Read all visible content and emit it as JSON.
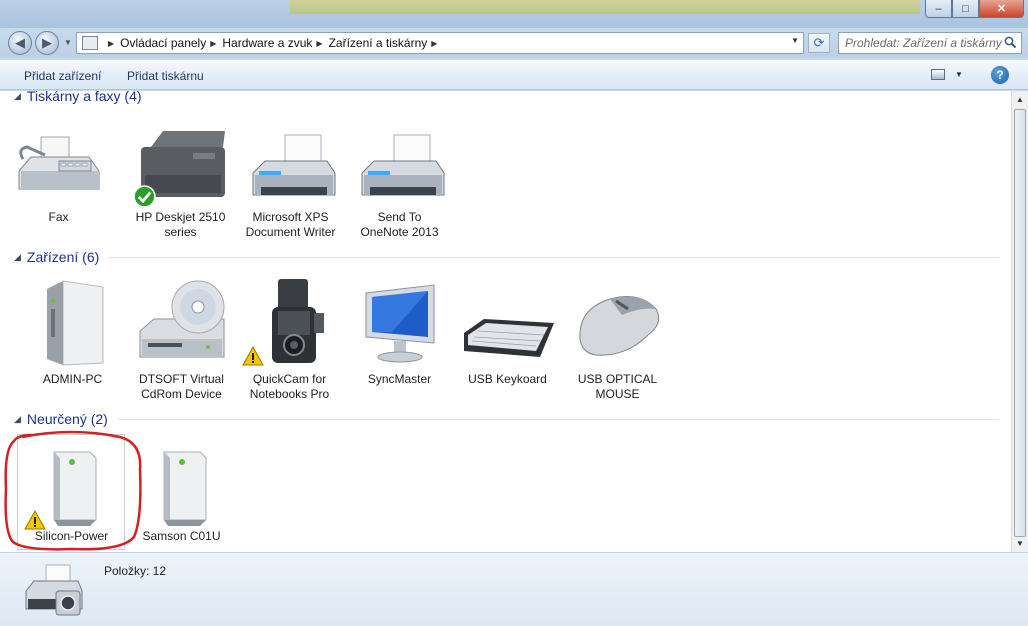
{
  "window": {
    "minimize": "–",
    "maximize": "□",
    "close": "✕"
  },
  "nav": {
    "breadcrumbs": [
      "Ovládací panely",
      "Hardware a zvuk",
      "Zařízení a tiskárny"
    ],
    "search_placeholder": "Prohledat: Zařízení a tiskárny"
  },
  "toolbar": {
    "add_device": "Přidat zařízení",
    "add_printer": "Přidat tiskárnu",
    "help": "?"
  },
  "groups": [
    {
      "title": "Tiskárny a faxy (4)",
      "items": [
        {
          "label1": "Fax",
          "label2": "",
          "icon": "fax-icon"
        },
        {
          "label1": "HP Deskjet 2510",
          "label2": "series",
          "icon": "printer-default-icon"
        },
        {
          "label1": "Microsoft XPS",
          "label2": "Document Writer",
          "icon": "printer-icon"
        },
        {
          "label1": "Send To",
          "label2": "OneNote 2013",
          "icon": "printer-icon"
        }
      ]
    },
    {
      "title": "Zařízení (6)",
      "items": [
        {
          "label1": "ADMIN-PC",
          "label2": "",
          "icon": "computer-tower-icon"
        },
        {
          "label1": "DTSOFT Virtual",
          "label2": "CdRom Device",
          "icon": "cd-drive-icon"
        },
        {
          "label1": "QuickCam for",
          "label2": "Notebooks Pro",
          "icon": "webcam-icon"
        },
        {
          "label1": "SyncMaster",
          "label2": "",
          "icon": "monitor-icon"
        },
        {
          "label1": "USB Keykoard",
          "label2": "",
          "icon": "keyboard-icon"
        },
        {
          "label1": "USB OPTICAL",
          "label2": "MOUSE",
          "icon": "mouse-icon"
        }
      ]
    },
    {
      "title": "Neurčený (2)",
      "items": [
        {
          "label1": "Silicon-Power",
          "label2": "",
          "icon": "external-drive-icon"
        },
        {
          "label1": "Samson C01U",
          "label2": "",
          "icon": "external-drive-icon"
        }
      ]
    }
  ],
  "status": {
    "items_label": "Položky: 12"
  },
  "colors": {
    "group_title": "#1e3287",
    "annotation_circle": "#d42020"
  }
}
